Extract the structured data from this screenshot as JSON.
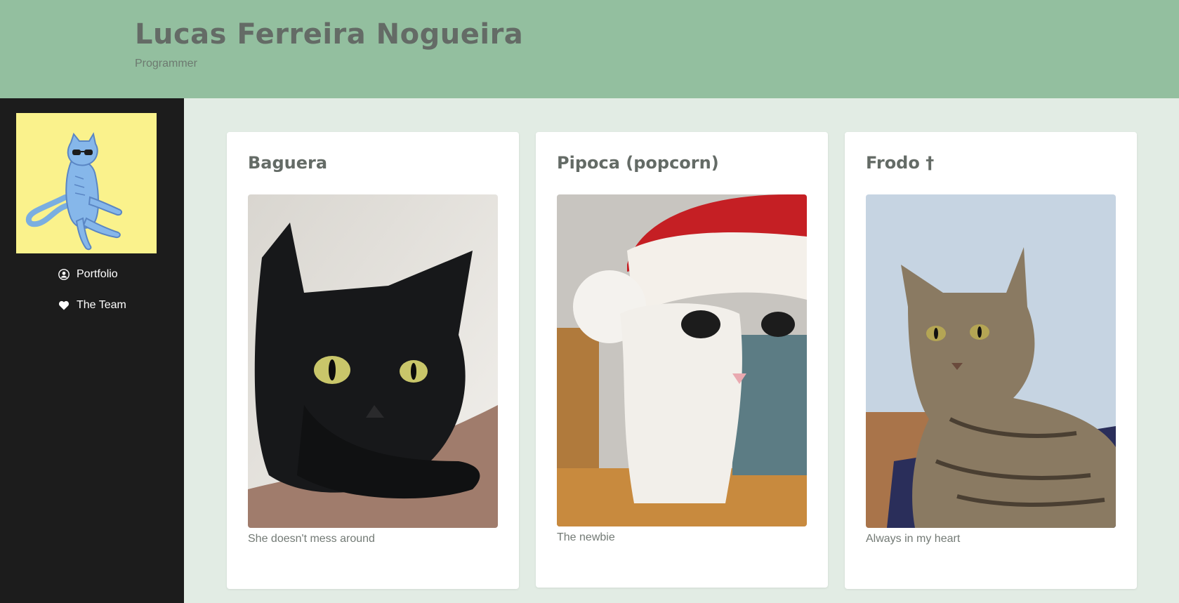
{
  "header": {
    "name": "Lucas Ferreira Nogueira",
    "role": "Programmer"
  },
  "sidebar": {
    "avatar_alt": "Illustration of a blue cat wearing sunglasses",
    "nav": [
      {
        "label": "Portfolio",
        "icon": "user-circle-icon"
      },
      {
        "label": "The Team",
        "icon": "heart-icon"
      }
    ]
  },
  "cards": [
    {
      "title": "Baguera",
      "caption": "She doesn't mess around",
      "photo": "black cat with yellow eyes"
    },
    {
      "title": "Pipoca (popcorn)",
      "caption": "The newbie",
      "photo": "white cat wearing a Santa hat"
    },
    {
      "title": "Frodo †",
      "caption": "Always in my heart",
      "photo": "tabby cat lying down"
    }
  ],
  "colors": {
    "header_bg": "#93bf9f",
    "page_bg": "#e2ece4",
    "sidebar_bg": "#1c1c1c",
    "avatar_bg": "#faf28c",
    "title_text": "#646b66"
  }
}
